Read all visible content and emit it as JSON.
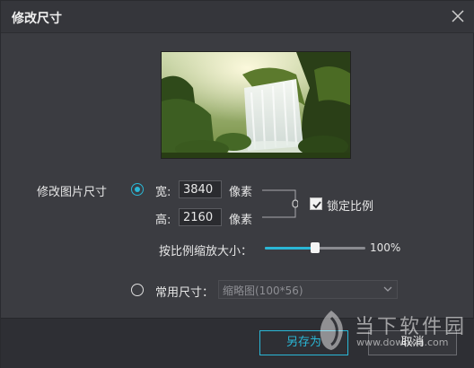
{
  "window": {
    "title": "修改尺寸"
  },
  "resize": {
    "section_label": "修改图片尺寸",
    "width_label": "宽:",
    "width_value": "3840",
    "height_label": "高:",
    "height_value": "2160",
    "unit": "像素",
    "lock_ratio_label": "锁定比例",
    "lock_ratio_checked": true,
    "scale_label": "按比例缩放大小：",
    "scale_percent": 100,
    "scale_display": "100%"
  },
  "common_size": {
    "label": "常用尺寸：",
    "selected": "缩略图(100*56)"
  },
  "footer": {
    "save_as_label": "另存为",
    "cancel_label": "取消"
  },
  "watermark": {
    "brand": "当下软件园",
    "url": "www.downxia.com"
  },
  "colors": {
    "accent": "#2ab7d6",
    "background": "#3b3c41",
    "footer": "#2e2f34"
  },
  "icons": {
    "close": "close-icon",
    "checkbox": "checkmark-icon",
    "select": "chevron-down-icon",
    "link": "link-icon"
  }
}
